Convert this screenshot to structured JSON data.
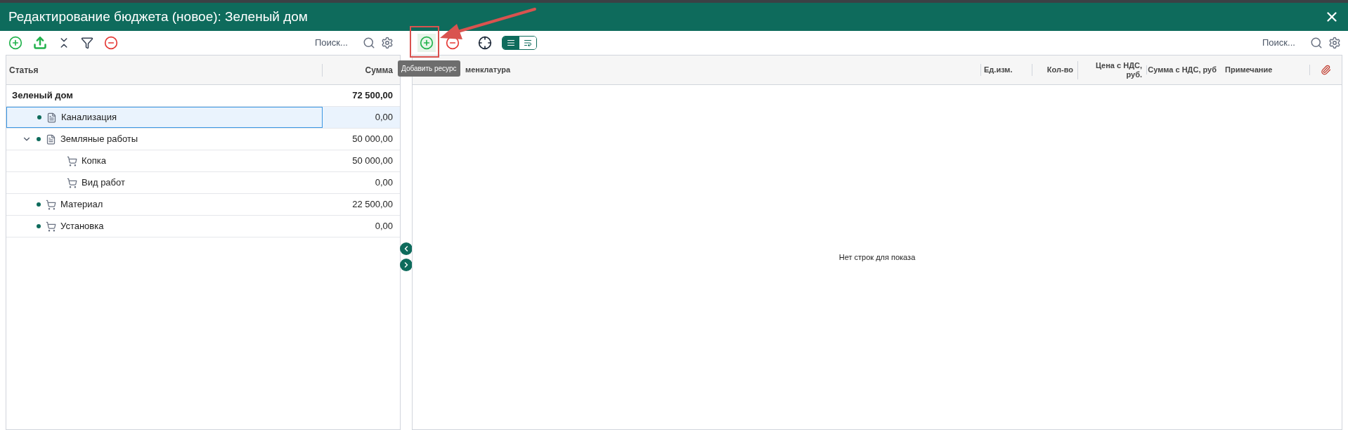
{
  "window": {
    "title": "Редактирование бюджета (новое): Зеленый дом"
  },
  "left_panel": {
    "search": {
      "placeholder": "Поиск..."
    },
    "columns": [
      "Статья",
      "Сумма"
    ],
    "tree": [
      {
        "label": "Зеленый дом",
        "amount": "72 500,00",
        "kind": "root",
        "selected": false,
        "children": [
          {
            "label": "Канализация",
            "amount": "0,00",
            "kind": "document",
            "dot": true,
            "selected": true
          },
          {
            "label": "Земляные работы",
            "amount": "50 000,00",
            "kind": "document",
            "dot": true,
            "selected": false,
            "expanded": true,
            "children": [
              {
                "label": "Копка",
                "amount": "50 000,00",
                "kind": "cart",
                "dot": false,
                "selected": false
              },
              {
                "label": "Вид работ",
                "amount": "0,00",
                "kind": "cart",
                "dot": false,
                "selected": false
              }
            ]
          },
          {
            "label": "Материал",
            "amount": "22 500,00",
            "kind": "cart",
            "dot": true,
            "selected": false
          },
          {
            "label": "Установка",
            "amount": "0,00",
            "kind": "cart",
            "dot": true,
            "selected": false
          }
        ]
      }
    ]
  },
  "right_panel": {
    "search": {
      "placeholder": "Поиск..."
    },
    "view_toggle": [
      {
        "kind": "list",
        "selected": true
      },
      {
        "kind": "wrap",
        "selected": false
      }
    ],
    "tooltip": "Добавить ресурс",
    "columns": [
      "менклатура",
      "Ед.изм.",
      "Кол-во",
      "Цена с НДС, руб.",
      "Сумма с НДС, руб",
      "Примечание"
    ],
    "empty_message": "Нет строк для показа"
  }
}
